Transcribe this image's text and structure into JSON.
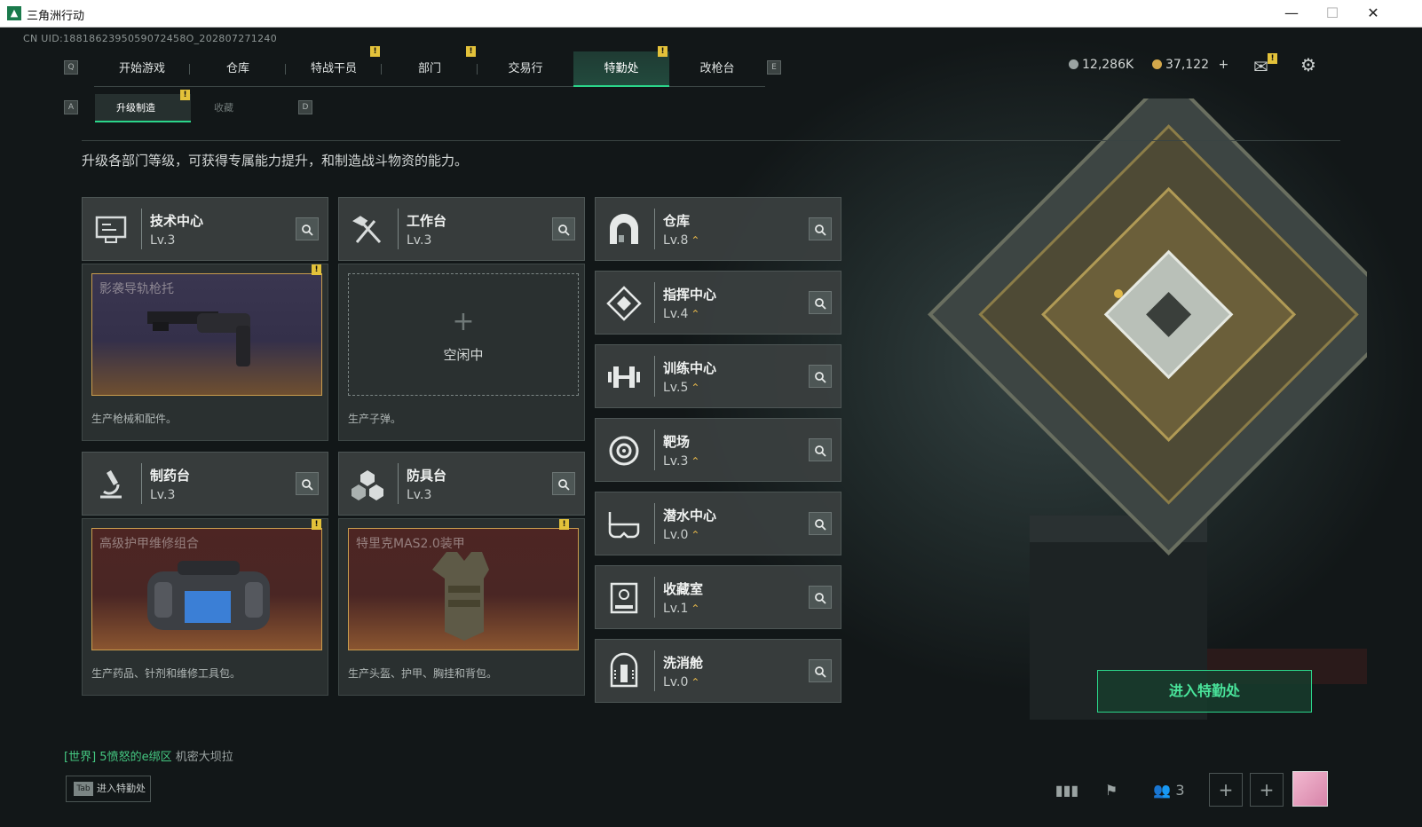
{
  "window": {
    "title": "三角洲行动",
    "minimize": "—",
    "maximize": "☐",
    "close": "✕"
  },
  "uid": "CN UID:1881862395059072458O_202807271240",
  "nav": {
    "key_left": "Q",
    "key_right": "E",
    "tabs": [
      {
        "label": "开始游戏"
      },
      {
        "label": "仓库"
      },
      {
        "label": "特战干员"
      },
      {
        "label": "部门"
      },
      {
        "label": "交易行"
      },
      {
        "label": "特勤处"
      },
      {
        "label": "改枪台"
      }
    ],
    "active_tab": "特勤处"
  },
  "currency": {
    "primary": "12,286K",
    "secondary": "37,122",
    "add": "+"
  },
  "badge_mark": "!",
  "subtabs": {
    "key_left": "A",
    "key_right": "D",
    "active": "升级制造",
    "inactive": "收藏"
  },
  "description": "升级各部门等级，可获得专属能力提升，和制造战斗物资的能力。",
  "workshops": {
    "tech": {
      "name": "技术中心",
      "level": "Lv.3",
      "item": "影袭导轨枪托",
      "caption": "生产枪械和配件。"
    },
    "workbench": {
      "name": "工作台",
      "level": "Lv.3",
      "idle_plus": "+",
      "idle": "空闲中",
      "caption": "生产子弹。"
    },
    "pharmacy": {
      "name": "制药台",
      "level": "Lv.3",
      "item": "高级护甲维修组合",
      "caption": "生产药品、针剂和维修工具包。"
    },
    "armor": {
      "name": "防具台",
      "level": "Lv.3",
      "item": "特里克MAS2.0装甲",
      "caption": "生产头盔、护甲、胸挂和背包。"
    }
  },
  "facilities": [
    {
      "name": "仓库",
      "level": "Lv.8"
    },
    {
      "name": "指挥中心",
      "level": "Lv.4"
    },
    {
      "name": "训练中心",
      "level": "Lv.5"
    },
    {
      "name": "靶场",
      "level": "Lv.3"
    },
    {
      "name": "潜水中心",
      "level": "Lv.0"
    },
    {
      "name": "收藏室",
      "level": "Lv.1"
    },
    {
      "name": "洗消舱",
      "level": "Lv.0"
    }
  ],
  "upgrade_arrow": "⌃",
  "enter_button": "进入特勤处",
  "chat": {
    "channel": "[世界]",
    "user": "5愤怒的e绑区",
    "message": "机密大坝拉"
  },
  "tab_hint": {
    "key": "Tab",
    "label": "进入特勤处"
  },
  "bottom": {
    "friends_count": "3",
    "add": "+"
  }
}
